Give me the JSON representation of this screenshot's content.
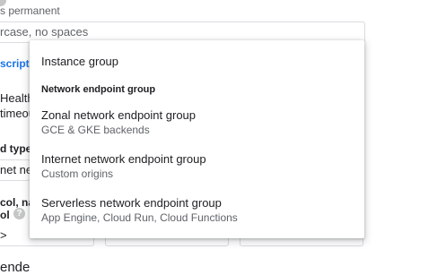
{
  "background": {
    "help_icon_glyph": "?",
    "permanent_note": "s permanent",
    "name_placeholder": "rcase, no spaces",
    "description_link": "scriptio",
    "health_label": "Health",
    "timeout_label": "timeou",
    "backend_type_label": "d type",
    "backend_type_value": "net ne",
    "protocol_label": "col, nar",
    "protocol_label_2": "ol",
    "field_fragment": ">",
    "bottom_heading": "ende"
  },
  "menu": {
    "instance_group": "Instance group",
    "section_header": "Network endpoint group",
    "zonal_primary": "Zonal network endpoint group",
    "zonal_secondary": "GCE & GKE backends",
    "internet_primary": "Internet network endpoint group",
    "internet_secondary": "Custom origins",
    "serverless_primary": "Serverless network endpoint group",
    "serverless_secondary": "App Engine, Cloud Run, Cloud Functions"
  }
}
